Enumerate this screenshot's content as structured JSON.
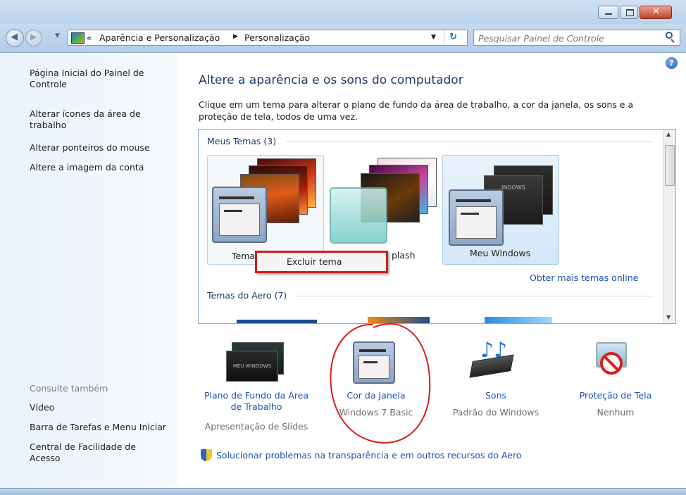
{
  "window": {
    "caption_buttons": [
      "minimize",
      "maximize",
      "close"
    ]
  },
  "address": {
    "prefix": "«",
    "crumb1": "Aparência e Personalização",
    "separator": "▶",
    "crumb2": "Personalização"
  },
  "search": {
    "placeholder": "Pesquisar Painel de Controle"
  },
  "sidebar": {
    "links": [
      "Página Inicial do Painel de Controle",
      "Alterar ícones da área de trabalho",
      "Alterar ponteiros do mouse",
      "Altere a imagem da conta"
    ],
    "see_also_title": "Consulte também",
    "see_also": [
      "Vídeo",
      "Barra de Tarefas e Menu Iniciar",
      "Central de Facilidade de Acesso"
    ]
  },
  "main": {
    "title": "Altere a aparência e os sons do computador",
    "description": "Clique em um tema para alterar o plano de fundo da área de trabalho, a cor da janela, os sons e a proteção de tela, todos de uma vez.",
    "my_themes_label": "Meus Temas (3)",
    "themes": [
      "Tema",
      "Splash",
      "Meu Windows"
    ],
    "theme_partial_label": "plash",
    "more_themes": "Obter mais temas online",
    "aero_label": "Temas do Aero (7)",
    "context_menu": {
      "item": "Excluir tema"
    }
  },
  "bottom": {
    "items": [
      {
        "label": "Plano de Fundo da Área de Trabalho",
        "line1": "Plano de Fundo da Área",
        "line2": "de Trabalho",
        "value": "Apresentação de Slides"
      },
      {
        "label": "Cor da Janela",
        "value": "Windows 7 Basic"
      },
      {
        "label": "Sons",
        "value": "Padrão do Windows"
      },
      {
        "label": "Proteção de Tela",
        "value": "Nenhum"
      }
    ],
    "troubleshoot": "Solucionar problemas na transparência e em outros recursos do Aero"
  },
  "colors": {
    "link": "#1a50b0",
    "annotation": "#d41c1c",
    "heading": "#1e3a6e"
  }
}
